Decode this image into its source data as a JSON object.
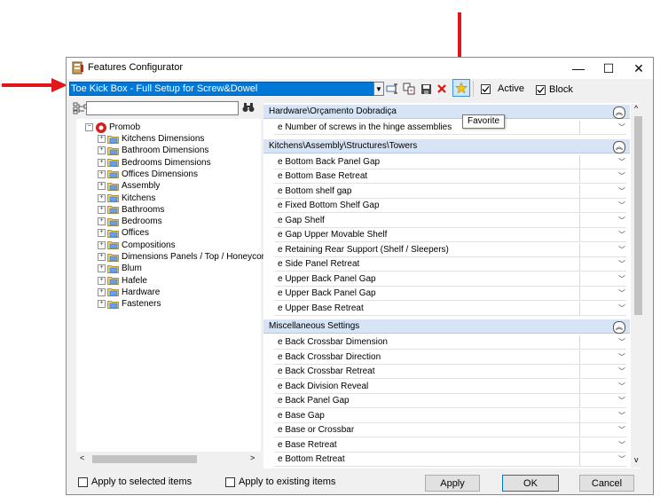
{
  "window": {
    "title": "Features Configurator",
    "controls": {
      "minimize": "—",
      "maximize": "☐",
      "close": "✕"
    }
  },
  "toolbar": {
    "combo_value": "Toe Kick Box - Full Setup for Screw&Dowel",
    "active_label": "Active",
    "block_label": "Block",
    "favorite_tooltip": "Favorite",
    "active_checked": true,
    "block_checked": true
  },
  "tree": {
    "root": "Promob",
    "items": [
      "Kitchens Dimensions",
      "Bathroom Dimensions",
      "Bedrooms Dimensions",
      "Offices Dimensions",
      "Assembly",
      "Kitchens",
      "Bathrooms",
      "Bedrooms",
      "Offices",
      "Compositions",
      "Dimensions Panels / Top / Honeycomb",
      "Blum",
      "Hafele",
      "Hardware",
      "Fasteners"
    ]
  },
  "groups": [
    {
      "title": "Hardware\\Orçamento Dobradiça",
      "props": [
        "e Number of screws in the hinge assemblies"
      ]
    },
    {
      "title": "Kitchens\\Assembly\\Structures\\Towers",
      "props": [
        "e Bottom Back Panel Gap",
        "e Bottom Base Retreat",
        "e Bottom shelf gap",
        "e Fixed Bottom Shelf Gap",
        "e Gap Shelf",
        "e Gap Upper Movable Shelf",
        "e Retaining Rear Support (Shelf / Sleepers)",
        "e Side Panel Retreat",
        "e Upper Back Panel Gap",
        "e Upper Back Panel Gap",
        "e Upper Base Retreat"
      ]
    },
    {
      "title": "Miscellaneous Settings",
      "props": [
        "e Back Crossbar Dimension",
        "e Back Crossbar Direction",
        "e Back Crossbar Retreat",
        "e Back Division Reveal",
        "e Back Panel Gap",
        "e Base Gap",
        "e Base or Crossbar",
        "e Base Retreat",
        "e Bottom Retreat"
      ]
    }
  ],
  "footer": {
    "apply_selected": "Apply to selected items",
    "apply_existing": "Apply to existing items",
    "apply_button": "Apply",
    "ok_button": "OK",
    "cancel_button": "Cancel"
  },
  "colors": {
    "selection_blue": "#0078d7",
    "group_header": "#d6e4f5",
    "annotation_arrow": "#e0161b"
  }
}
